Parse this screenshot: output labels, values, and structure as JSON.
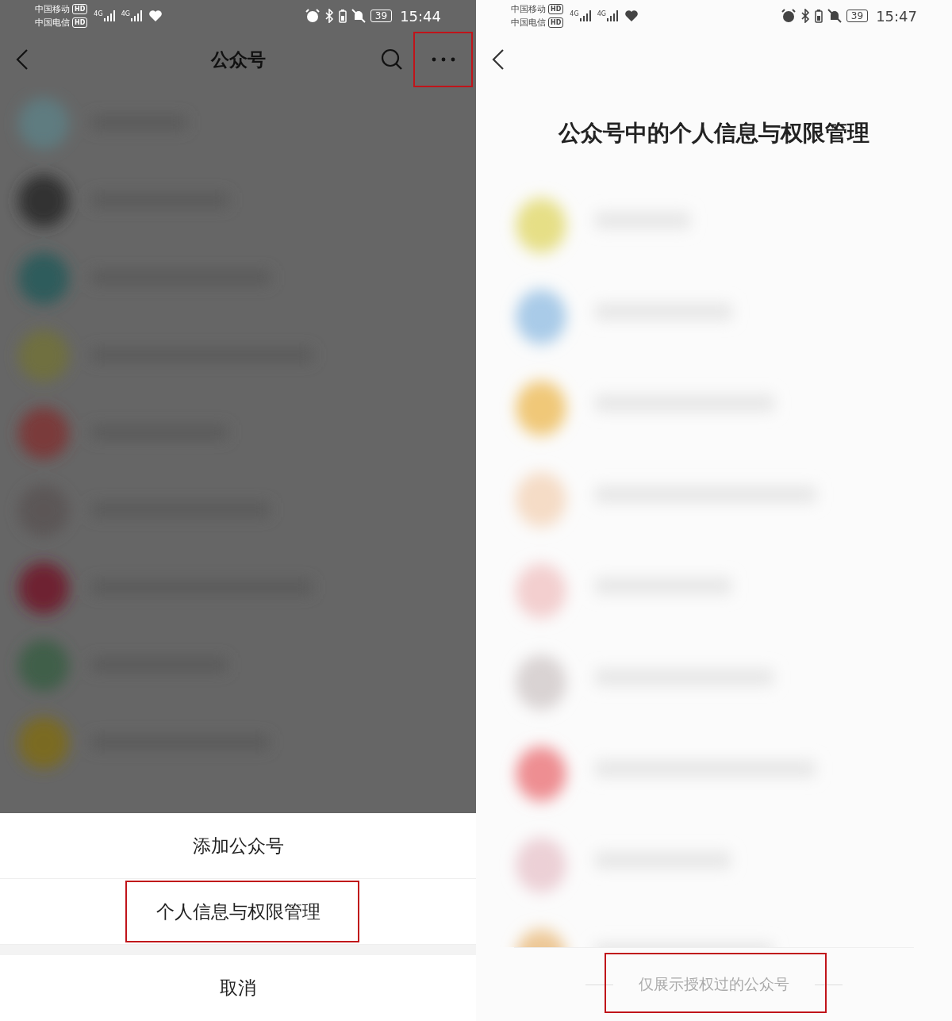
{
  "left": {
    "dimmed": true,
    "status_bar": {
      "carriers": [
        {
          "name": "中国移动",
          "badge": "HD"
        },
        {
          "name": "中国电信",
          "badge": "HD"
        }
      ],
      "signals": [
        "4G",
        "4G"
      ],
      "battery": "39",
      "time": "15:44"
    },
    "nav": {
      "title": "公众号",
      "more_highlighted": true
    },
    "sheet": {
      "items": [
        {
          "label": "添加公众号",
          "highlighted": false
        },
        {
          "label": "个人信息与权限管理",
          "highlighted": true
        }
      ],
      "cancel": "取消"
    }
  },
  "right": {
    "dimmed": false,
    "status_bar": {
      "carriers": [
        {
          "name": "中国移动",
          "badge": "HD"
        },
        {
          "name": "中国电信",
          "badge": "HD"
        }
      ],
      "signals": [
        "4G",
        "4G"
      ],
      "battery": "39",
      "time": "15:47"
    },
    "title": "公众号中的个人信息与权限管理",
    "footer": {
      "text": "仅展示授权过的公众号",
      "highlighted": true
    }
  }
}
